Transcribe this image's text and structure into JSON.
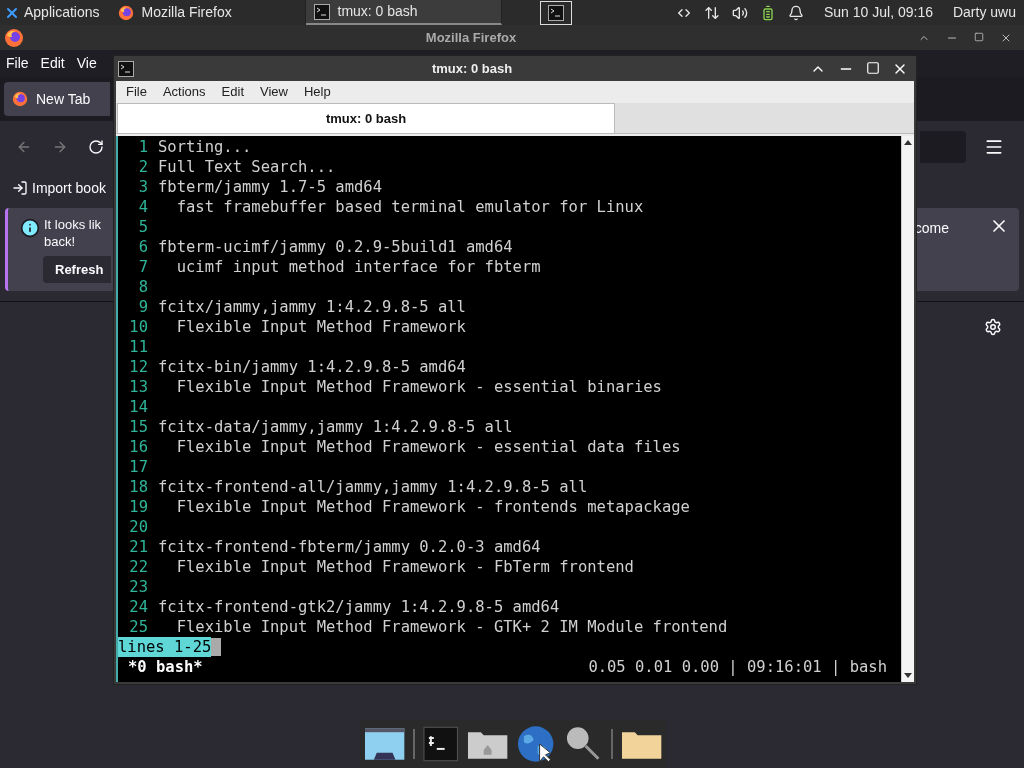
{
  "top_panel": {
    "menu_label": "Applications",
    "tasks": [
      {
        "label": "Mozilla Firefox",
        "kind": "firefox",
        "selected": false
      },
      {
        "label": "tmux: 0 bash",
        "kind": "terminal",
        "selected": true
      }
    ],
    "clock": "Sun 10 Jul, 09:16",
    "user": "Darty uwu"
  },
  "firefox": {
    "title": "Mozilla Firefox",
    "menu": [
      "File",
      "Edit",
      "Vie"
    ],
    "tabs": [
      {
        "label": "New Tab",
        "selected": true
      }
    ],
    "bookmark": "Import book",
    "notification": {
      "text_left": "It looks lik",
      "text_left_2": "back!",
      "text_right": "come",
      "button": "Refresh"
    }
  },
  "terminal": {
    "title": "tmux: 0 bash",
    "menu": [
      "File",
      "Actions",
      "Edit",
      "View",
      "Help"
    ],
    "tabs": [
      {
        "label": "tmux: 0 bash",
        "selected": true
      }
    ],
    "lines": [
      {
        "number": "1",
        "text": "Sorting..."
      },
      {
        "number": "2",
        "text": "Full Text Search..."
      },
      {
        "number": "3",
        "text": "fbterm/jammy 1.7-5 amd64"
      },
      {
        "number": "4",
        "text": "  fast framebuffer based terminal emulator for Linux"
      },
      {
        "number": "5"
      },
      {
        "number": "6",
        "text": "fbterm-ucimf/jammy 0.2.9-5build1 amd64"
      },
      {
        "number": "7",
        "text": "  ucimf input method interface for fbterm"
      },
      {
        "number": "8"
      },
      {
        "number": "9",
        "text": "fcitx/jammy,jammy 1:4.2.9.8-5 all"
      },
      {
        "number": "10",
        "text": "  Flexible Input Method Framework"
      },
      {
        "number": "11"
      },
      {
        "number": "12",
        "text": "fcitx-bin/jammy 1:4.2.9.8-5 amd64"
      },
      {
        "number": "13",
        "text": "  Flexible Input Method Framework - essential binaries"
      },
      {
        "number": "14"
      },
      {
        "number": "15",
        "text": "fcitx-data/jammy,jammy 1:4.2.9.8-5 all"
      },
      {
        "number": "16",
        "text": "  Flexible Input Method Framework - essential data files"
      },
      {
        "number": "17"
      },
      {
        "number": "18",
        "text": "fcitx-frontend-all/jammy,jammy 1:4.2.9.8-5 all"
      },
      {
        "number": "19",
        "text": "  Flexible Input Method Framework - frontends metapackage"
      },
      {
        "number": "20"
      },
      {
        "number": "21",
        "text": "fcitx-frontend-fbterm/jammy 0.2.0-3 amd64"
      },
      {
        "number": "22",
        "text": "  Flexible Input Method Framework - FbTerm frontend"
      },
      {
        "number": "23"
      },
      {
        "number": "24",
        "text": "fcitx-frontend-gtk2/jammy 1:4.2.9.8-5 amd64"
      },
      {
        "number": "25",
        "text": "  Flexible Input Method Framework - GTK+ 2 IM Module frontend"
      }
    ],
    "pager_status": "lines 1-25",
    "tmux_window": "*0 bash*",
    "tmux_right": "0.05 0.01 0.00 | 09:16:01 | bash"
  }
}
